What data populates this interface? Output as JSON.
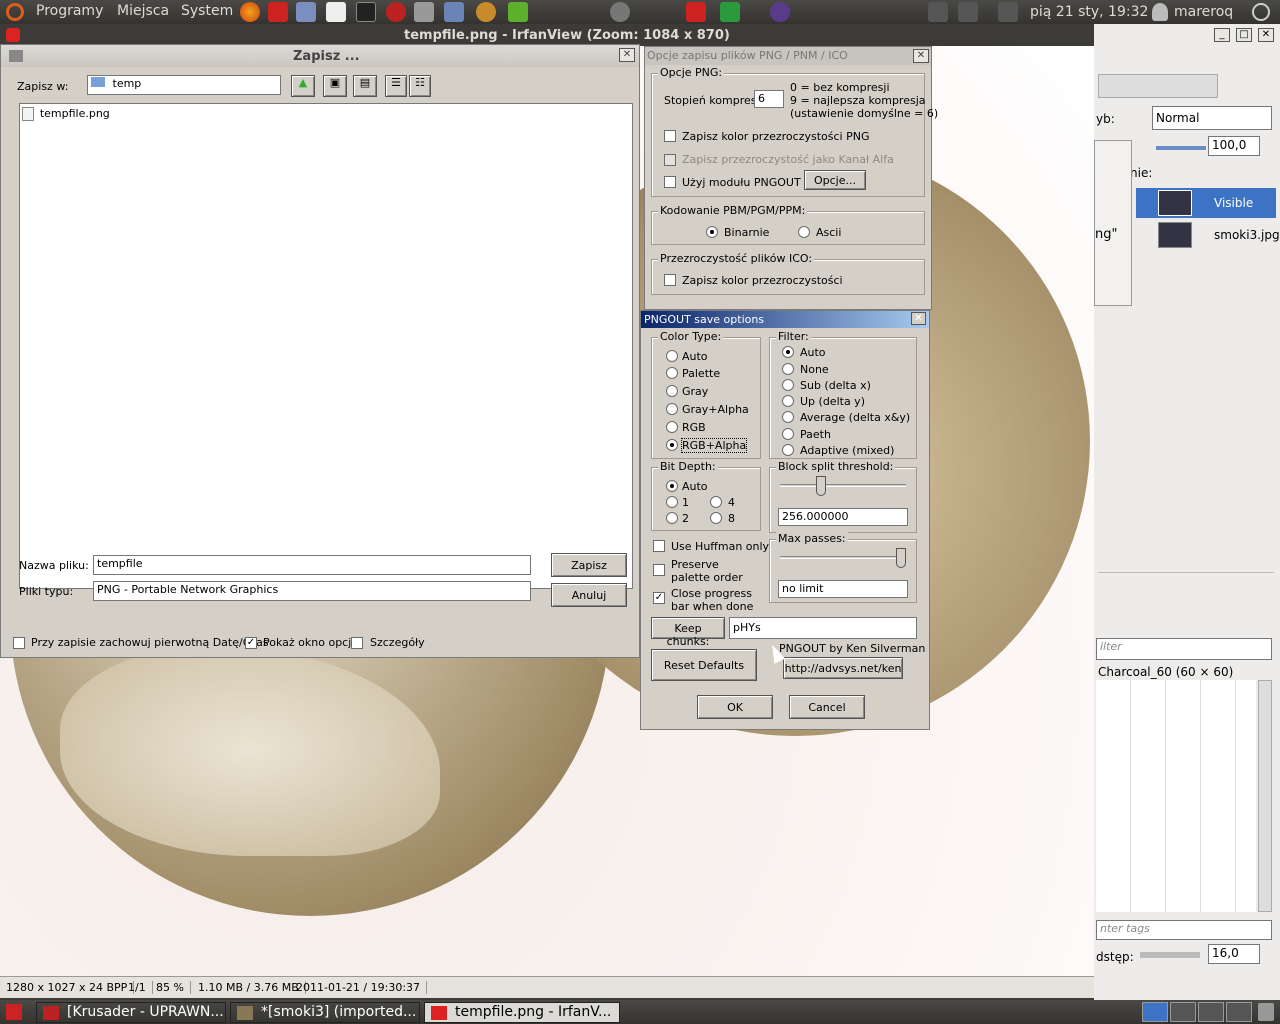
{
  "top_panel": {
    "menus": [
      "Programy",
      "Miejsca",
      "System"
    ],
    "clock": "pią 21 sty, 19:32",
    "user": "mareroq"
  },
  "irfanview": {
    "title": "tempfile.png - IrfanView (Zoom: 1084 x 870)",
    "status": [
      "1280 x 1027 x 24 BPP",
      "1/1",
      "85 %",
      "1.10 MB / 3.76 MB",
      "2011-01-21 / 19:30:37"
    ]
  },
  "save_dialog": {
    "title": "Zapisz ...",
    "save_in_label": "Zapisz w:",
    "folder": "temp",
    "files": [
      "tempfile.png"
    ],
    "filename_label": "Nazwa pliku:",
    "filename_value": "tempfile",
    "filetype_label": "Pliki typu:",
    "filetype_value": "PNG - Portable Network Graphics",
    "save_button": "Zapisz",
    "cancel_button": "Anuluj",
    "opt_keep_date": "Przy zapisie zachowuj pierwotną Datę/Czas",
    "opt_show_options": "Pokaż okno opcji",
    "opt_details": "Szczegóły"
  },
  "png_options": {
    "title": "Opcje zapisu plików PNG / PNM / ICO",
    "group_png": "Opcje PNG:",
    "compression_label": "Stopień kompresji:",
    "compression_value": "6",
    "compression_hint1": "0 = bez kompresji",
    "compression_hint2": "9 = najlepsza kompresja",
    "compression_hint3": "(ustawienie domyślne = 6)",
    "save_transparent": "Zapisz kolor przezroczystości PNG",
    "save_alpha": "Zapisz przezroczystość jako Kanał Alfa",
    "use_pngout": "Użyj modułu PNGOUT",
    "options_button": "Opcje...",
    "group_pbm": "Kodowanie PBM/PGM/PPM:",
    "binary": "Binarnie",
    "ascii": "Ascii",
    "group_ico": "Przezroczystość plików ICO:",
    "ico_transparent": "Zapisz kolor przezroczystości"
  },
  "pngout": {
    "title": "PNGOUT save options",
    "color_type_label": "Color Type:",
    "color_types": [
      "Auto",
      "Palette",
      "Gray",
      "Gray+Alpha",
      "RGB",
      "RGB+Alpha"
    ],
    "color_type_selected": "RGB+Alpha",
    "filter_label": "Filter:",
    "filters": [
      "Auto",
      "None",
      "Sub (delta x)",
      "Up (delta y)",
      "Average (delta x&y)",
      "Paeth",
      "Adaptive (mixed)"
    ],
    "filter_selected": "Auto",
    "bit_depth_label": "Bit Depth:",
    "bit_depths": [
      "Auto",
      "1",
      "2",
      "4",
      "8"
    ],
    "bit_depth_selected": "Auto",
    "block_split_label": "Block split threshold:",
    "block_split_value": "256.000000",
    "use_huffman": "Use Huffman only",
    "preserve_palette": "Preserve palette order",
    "close_progress": "Close progress bar when done",
    "max_passes_label": "Max passes:",
    "max_passes_value": "no limit",
    "keep_chunks_button": "Keep chunks:",
    "keep_chunks_value": "pHYs",
    "reset_defaults": "Reset Defaults",
    "credit": "PNGOUT by Ken Silverman",
    "url_button": "http://advsys.net/ken",
    "ok": "OK",
    "cancel": "Cancel"
  },
  "gimp": {
    "mode_label": "yb:",
    "mode_value": "Normal",
    "opacity_value": "100,0",
    "lock_label": "nie:",
    "layers": [
      "Visible",
      "smoki3.jpg"
    ],
    "partial_text": "ng\"",
    "filter_placeholder": "ilter",
    "brush_name": "Charcoal_60 (60 × 60)",
    "tags_placeholder": "nter tags",
    "spacing_label": "dstęp:",
    "spacing_value": "16,0"
  },
  "taskbar": {
    "tasks": [
      "[Krusader - UPRAWN...",
      "*[smoki3] (imported...",
      "tempfile.png - IrfanV..."
    ]
  }
}
